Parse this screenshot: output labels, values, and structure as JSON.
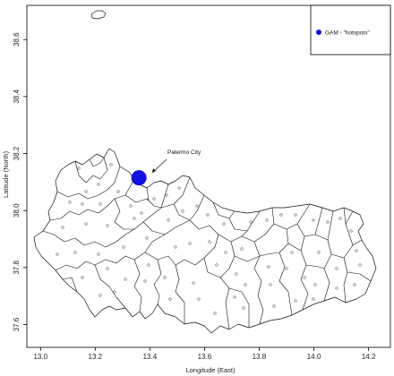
{
  "map": {
    "xlabel": "Longitude (East)",
    "ylabel": "Latitude (North)",
    "x_ticks": [
      "13.0",
      "13.2",
      "13.4",
      "13.6",
      "13.8",
      "14.0",
      "14.2"
    ],
    "y_ticks": [
      "37.6",
      "37.8",
      "38.0",
      "38.2",
      "38.4",
      "38.6"
    ],
    "x_range": [
      12.95,
      14.28
    ],
    "y_range": [
      37.52,
      38.72
    ],
    "legend": {
      "label": "GAM - \"hotspots\"",
      "marker_color": "#1010e0"
    },
    "annotation": {
      "label": "Palermo City"
    },
    "hotspot": {
      "lon": 13.36,
      "lat": 38.115,
      "color": "#1010e0"
    }
  }
}
